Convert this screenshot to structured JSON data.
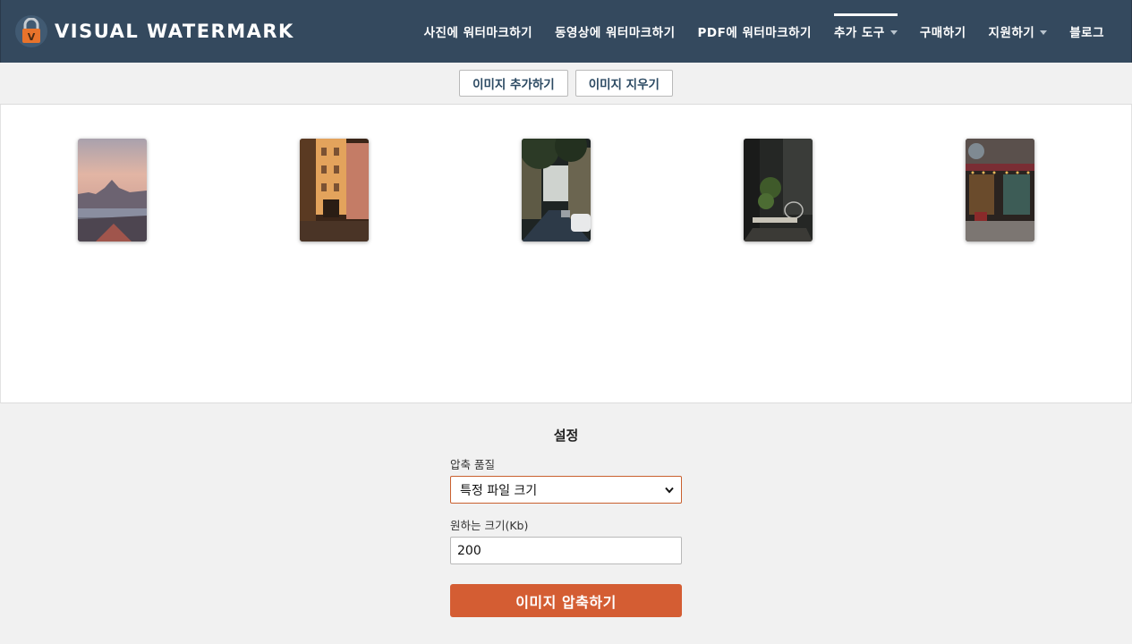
{
  "header": {
    "brand": "VISUAL WATERMARK",
    "brand_color": "#34495e",
    "logo_icon": "padlock-v-icon",
    "nav": [
      {
        "label": "사진에 워터마크하기",
        "dropdown": false,
        "active": false
      },
      {
        "label": "동영상에 워터마크하기",
        "dropdown": false,
        "active": false
      },
      {
        "label": "PDF에 워터마크하기",
        "dropdown": false,
        "active": false
      },
      {
        "label": "추가 도구",
        "dropdown": true,
        "active": true
      },
      {
        "label": "구매하기",
        "dropdown": false,
        "active": false
      },
      {
        "label": "지원하기",
        "dropdown": true,
        "active": false
      },
      {
        "label": "블로그",
        "dropdown": false,
        "active": false
      }
    ]
  },
  "toolbar": {
    "add_images": "이미지 추가하기",
    "clear_images": "이미지 지우기"
  },
  "gallery": {
    "images": [
      {
        "subject": "city-skyline-at-dusk"
      },
      {
        "subject": "narrow-courtyard-buildings"
      },
      {
        "subject": "street-with-parked-cars"
      },
      {
        "subject": "dark-cafe-terrace"
      },
      {
        "subject": "lit-storefront-at-night"
      }
    ]
  },
  "settings": {
    "title": "설정",
    "quality_label": "압축 품질",
    "quality_value": "특정 파일 크기",
    "size_label": "원하는 크기(Kb)",
    "size_value": "200",
    "compress_button": "이미지 압축하기",
    "accent_color": "#d45d33"
  }
}
